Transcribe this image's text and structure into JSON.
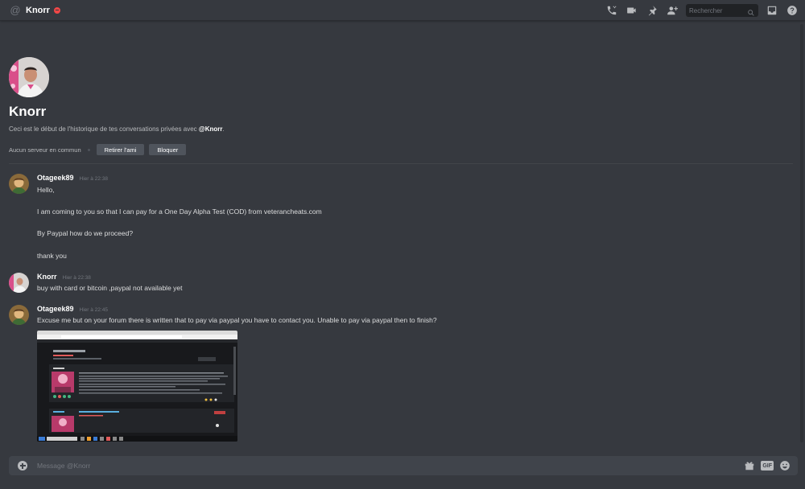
{
  "header": {
    "title": "Knorr",
    "search_placeholder": "Rechercher",
    "icons": [
      "call-icon",
      "video-icon",
      "pin-icon",
      "add-friend-icon",
      "search-icon",
      "inbox-icon",
      "help-icon"
    ]
  },
  "intro": {
    "name": "Knorr",
    "text_prefix": "Ceci est le début de l'historique de tes conversations privées avec ",
    "text_user": "@Knorr",
    "text_suffix": ".",
    "no_mutual_server": "Aucun serveur en commun",
    "remove_friend_label": "Retirer l'ami",
    "block_label": "Bloquer"
  },
  "messages": [
    {
      "author": "Otageek89",
      "time": "Hier à 22:38",
      "lines": [
        "Hello,",
        "I am coming to you so that I can pay for a One Day Alpha Test (COD) from veterancheats.com",
        "By Paypal how do we proceed?",
        "thank you"
      ]
    },
    {
      "author": "Knorr",
      "time": "Hier à 22:38",
      "lines": [
        "buy with card or bitcoin ,paypal not available yet"
      ]
    },
    {
      "author": "Otageek89",
      "time": "Hier à 22:45",
      "lines": [
        "Excuse me but on your forum there is written that to pay via paypal you have to contact you. Unable to pay via paypal then to finish?"
      ]
    }
  ],
  "composer": {
    "placeholder": "Message @Knorr",
    "gif_label": "GIF"
  },
  "colors": {
    "background": "#36393f",
    "dnd_status": "#f04747",
    "button": "#4f545c",
    "input": "#40444b"
  }
}
